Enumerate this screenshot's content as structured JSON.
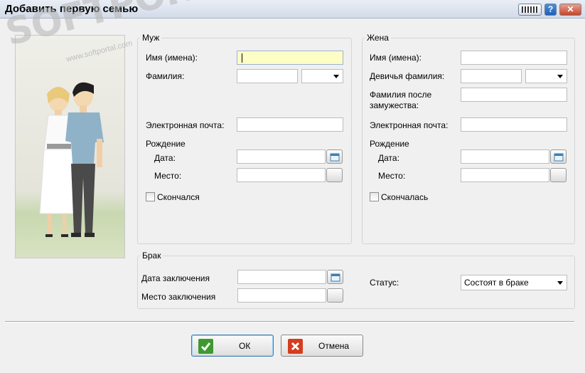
{
  "window": {
    "title": "Добавить первую семью",
    "help": "?",
    "close": "✕"
  },
  "watermark": {
    "logo": "SOFTPORTAL",
    "tm": "™",
    "url": "www.softportal.com"
  },
  "husband": {
    "legend": "Муж",
    "first_name_label": "Имя (имена):",
    "first_name_value": "",
    "last_name_label": "Фамилия:",
    "email_label": "Электронная почта:",
    "birth_label": "Рождение",
    "date_label": "Дата:",
    "place_label": "Место:",
    "deceased_label": "Скончался"
  },
  "wife": {
    "legend": "Жена",
    "first_name_label": "Имя (имена):",
    "maiden_label": "Девичья фамилия:",
    "married_label_1": "Фамилия после",
    "married_label_2": "замужества:",
    "email_label": "Электронная почта:",
    "birth_label": "Рождение",
    "date_label": "Дата:",
    "place_label": "Место:",
    "deceased_label": "Скончалась"
  },
  "marriage": {
    "legend": "Брак",
    "date_label": "Дата заключения",
    "place_label": "Место заключения",
    "status_label": "Статус:",
    "status_value": "Состоят в браке"
  },
  "buttons": {
    "ok": "ОК",
    "cancel": "Отмена"
  },
  "colors": {
    "focus_field": "#fdfdc6",
    "ok_icon": "#3d9a2f",
    "cancel_icon": "#d43d1e"
  }
}
